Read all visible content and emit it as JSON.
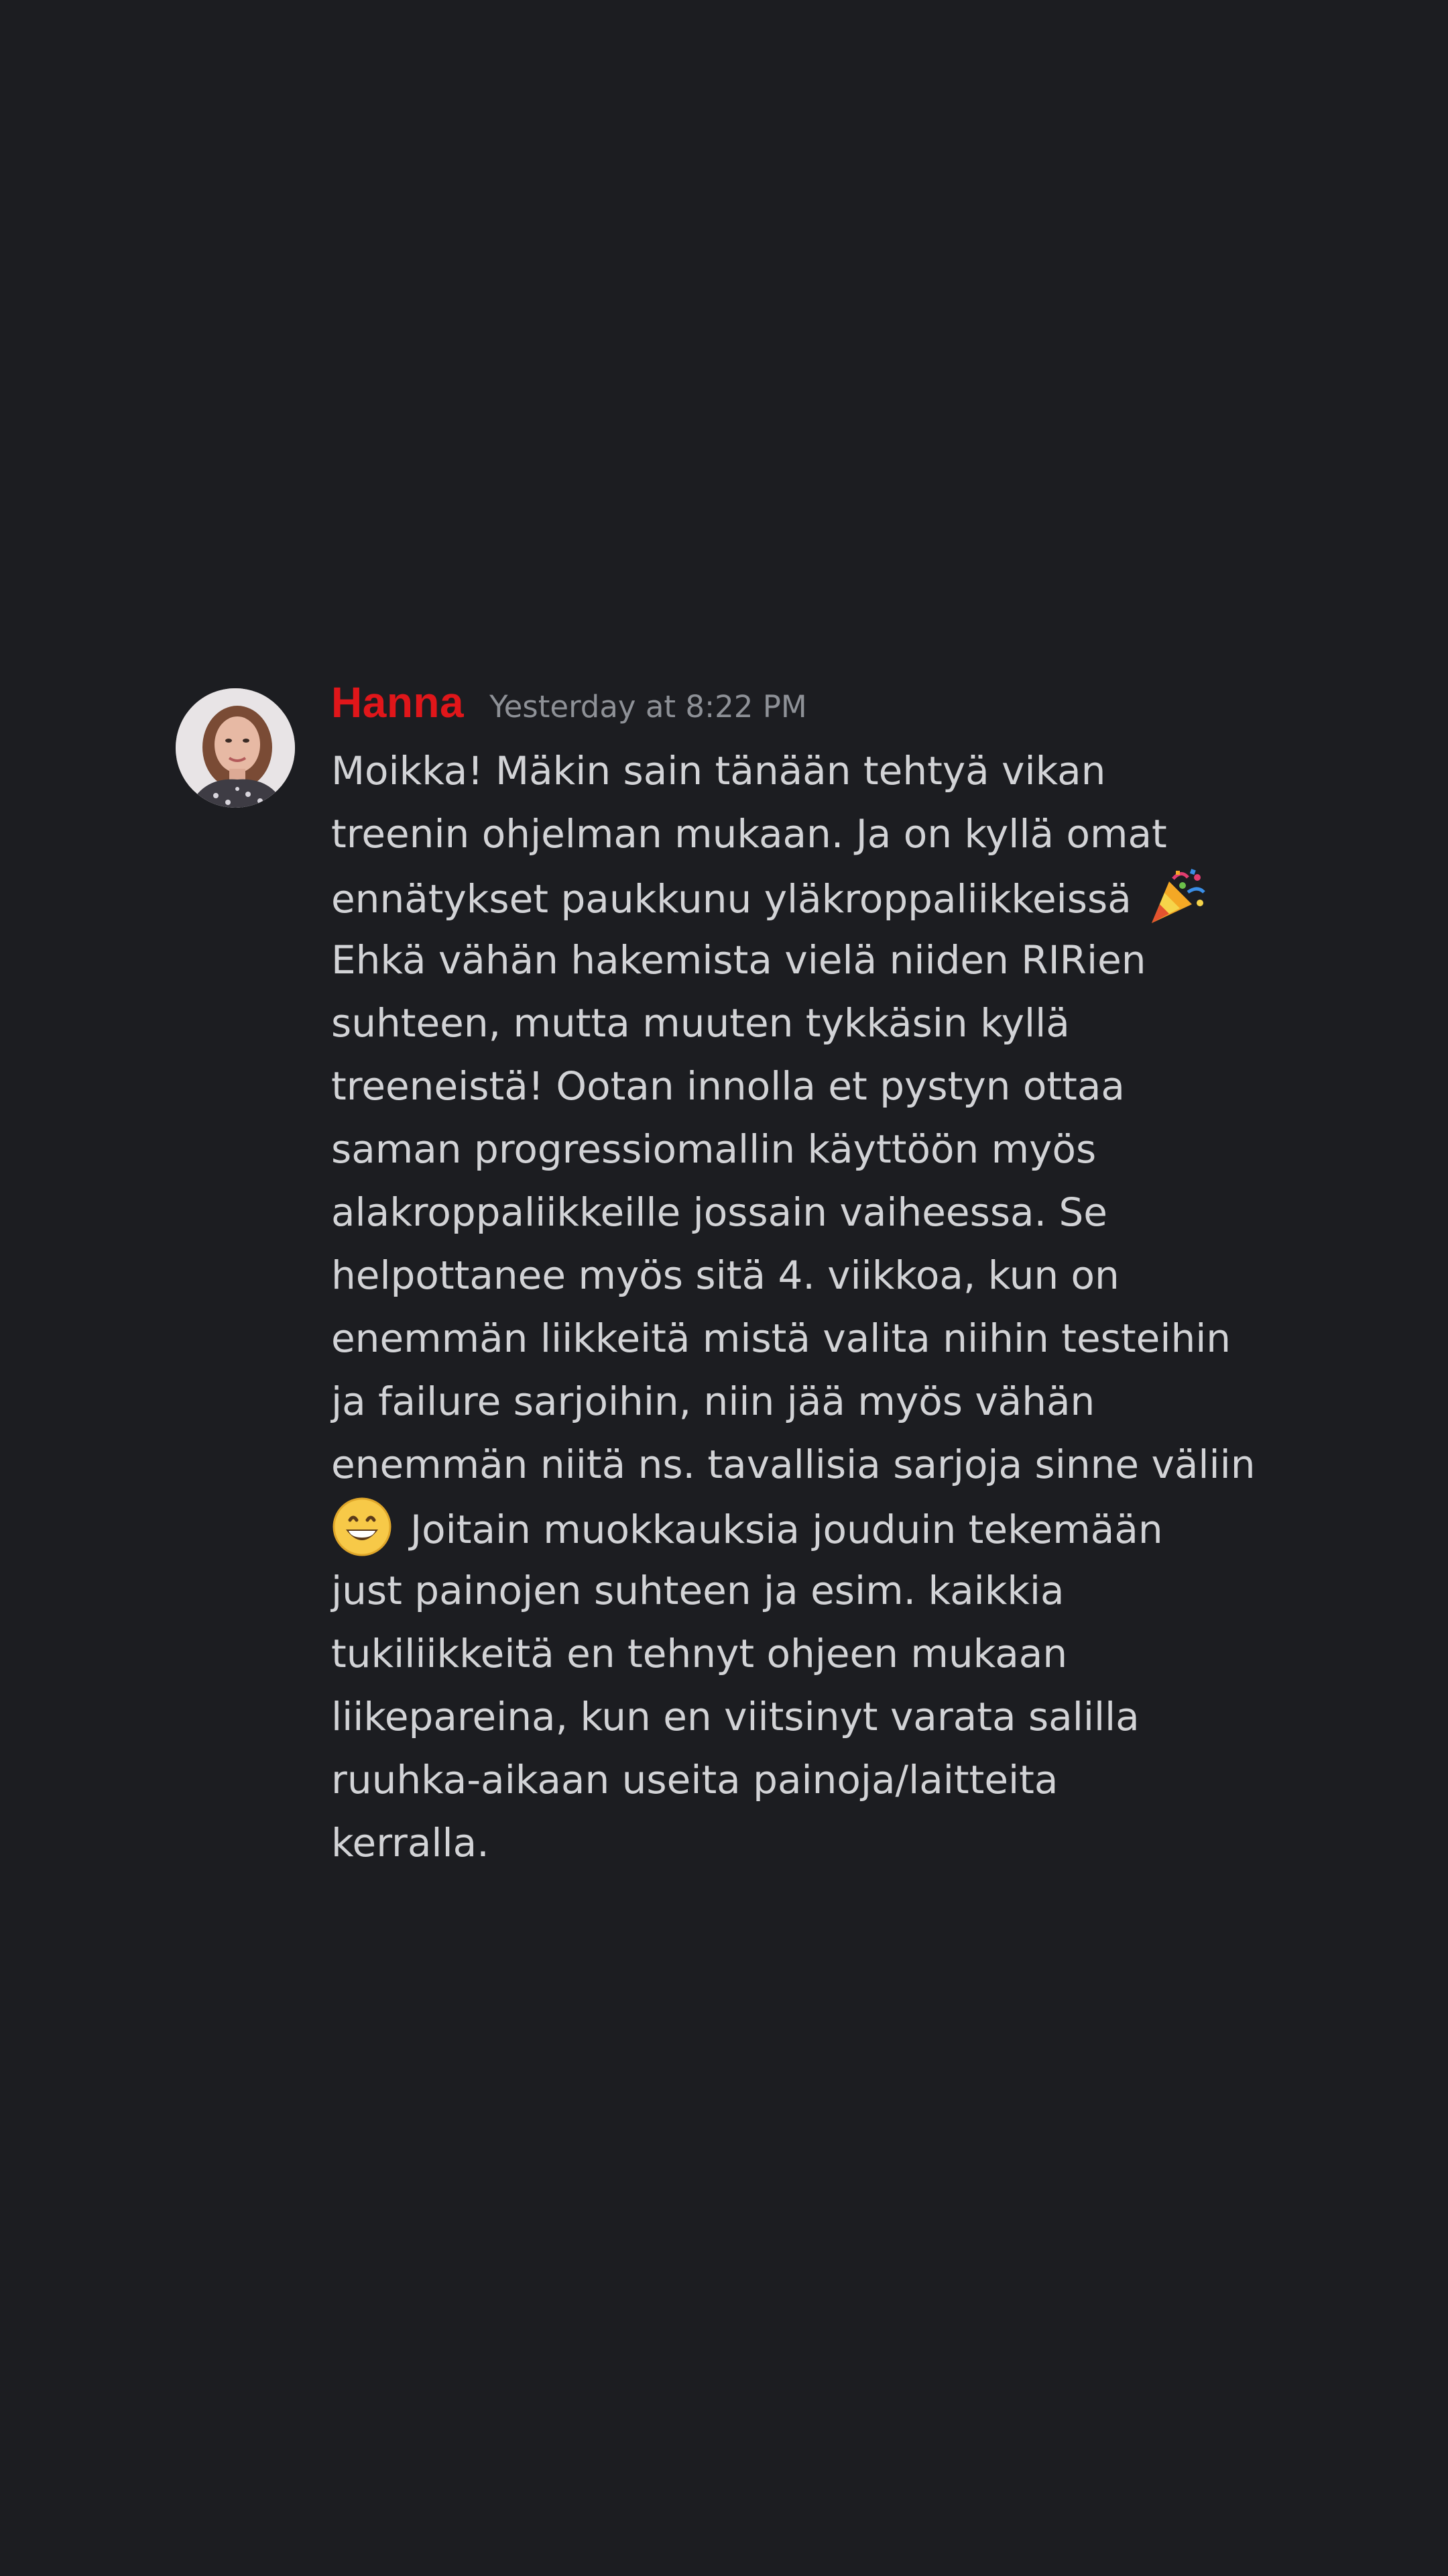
{
  "message": {
    "author": "Hanna",
    "timestamp": "Yesterday at 8:22 PM",
    "author_color": "#e0161a",
    "avatar_icon": "user-avatar-photo",
    "lines": [
      "Moikka! Mäkin sain tänään tehtyä vikan",
      "treenin ohjelman mukaan. Ja on kyllä omat",
      "ennätykset paukkunu yläkroppaliikkeissä",
      "Ehkä vähän hakemista vielä niiden RIRien",
      "suhteen, mutta muuten tykkäsin kyllä",
      "treeneistä! Ootan innolla et pystyn ottaa",
      "saman progressiomallin käyttöön myös",
      "alakroppaliikkeille jossain vaiheessa. Se",
      "helpottanee myös sitä 4. viikkoa, kun on",
      "enemmän liikkeitä mistä valita niihin testeihin",
      "ja failure sarjoihin, niin jää myös vähän",
      "enemmän niitä ns. tavallisia sarjoja sinne väliin",
      "Joitain muokkauksia jouduin tekemään",
      "just painojen suhteen ja esim. kaikkia",
      "tukiliikkeitä en tehnyt ohjeen mukaan",
      "liikepareina, kun en viitsinyt varata salilla",
      "ruuhka-aikaan useita painoja/laitteita",
      "kerralla."
    ],
    "emojis": {
      "party": "party-popper-icon",
      "grin": "grinning-face-icon"
    }
  },
  "colors": {
    "background": "#1c1d21",
    "text": "#d2d3d6",
    "timestamp": "#8e9197"
  }
}
